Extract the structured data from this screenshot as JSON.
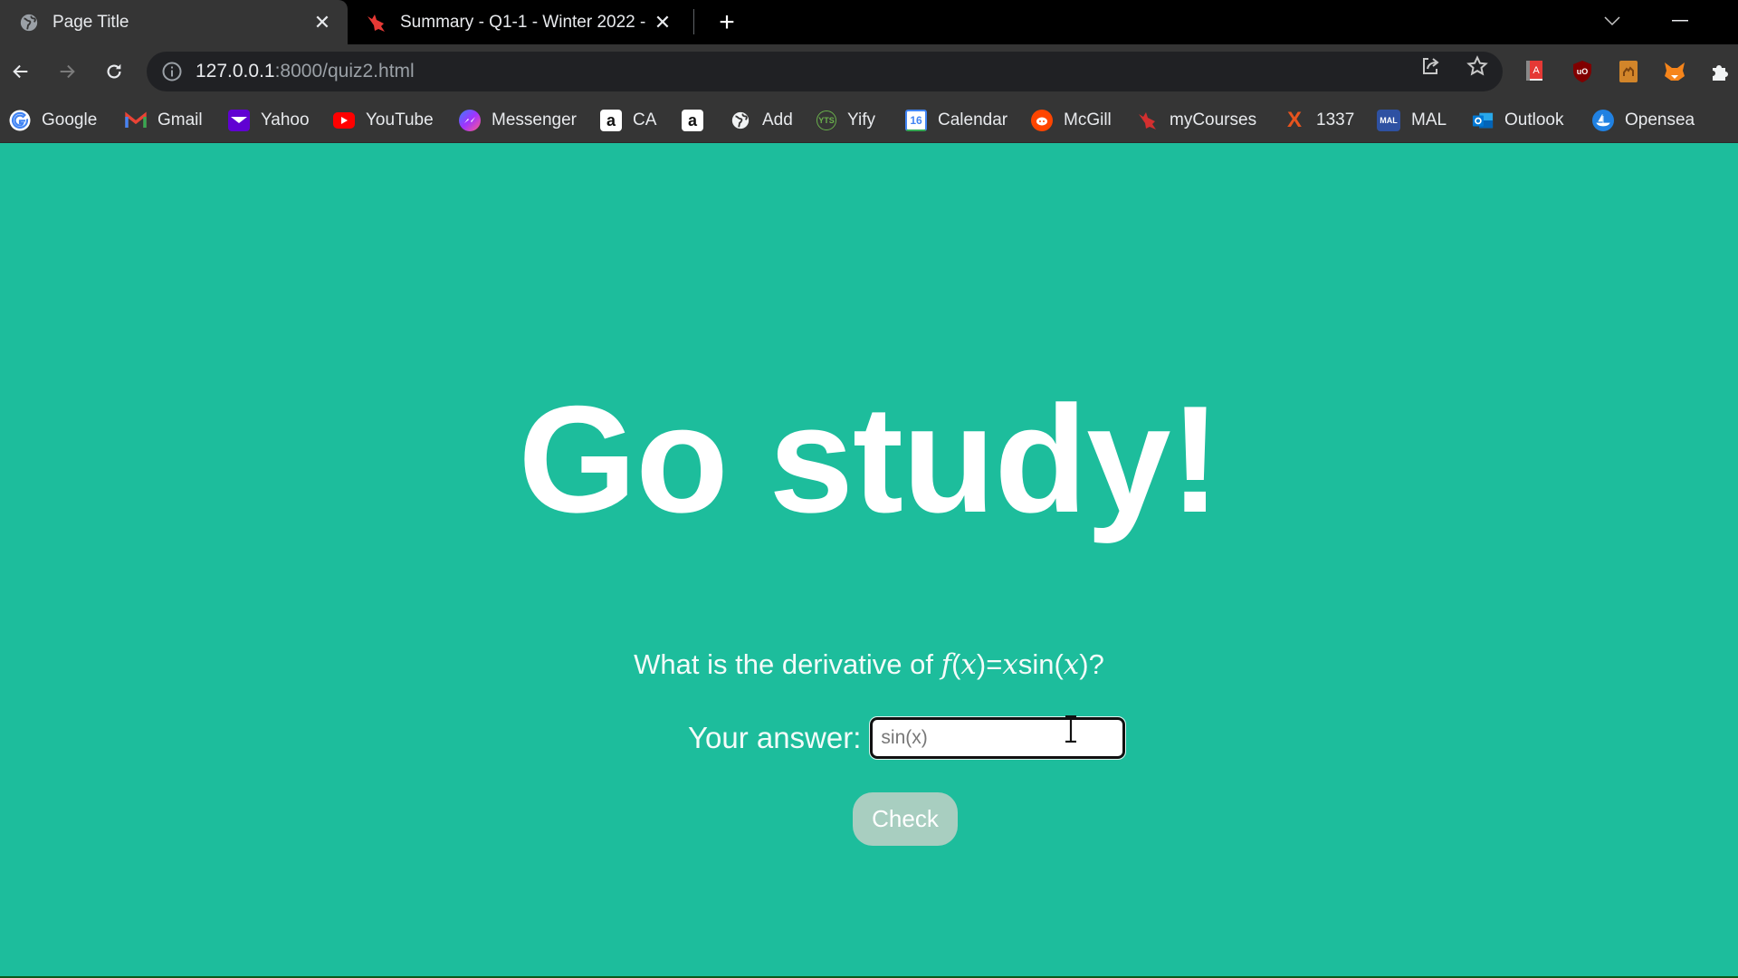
{
  "browser": {
    "tabs": [
      {
        "title": "Page Title",
        "icon": "globe-icon",
        "active": true
      },
      {
        "title": "Summary - Q1-1 - Winter 2022 -",
        "icon": "mycourses-bird-icon",
        "active": false
      }
    ],
    "close_glyph": "✕",
    "new_tab_glyph": "+",
    "address": {
      "host": "127.0.0.1",
      "rest": ":8000/quiz2.html"
    },
    "toolbar_icons": [
      "back-arrow-icon",
      "forward-arrow-icon",
      "reload-icon",
      "info-icon",
      "share-icon",
      "star-icon"
    ],
    "extensions": [
      "dictionary-extension-icon",
      "ublock-origin-icon",
      "camel-extension-icon",
      "metamask-fox-icon",
      "puzzle-extensions-icon"
    ],
    "bookmarks": [
      {
        "label": "Google",
        "icon": "google-icon",
        "color": "#4285f4"
      },
      {
        "label": "Gmail",
        "icon": "gmail-icon",
        "color": "#ea4335"
      },
      {
        "label": "Yahoo",
        "icon": "yahoo-icon",
        "color": "#6001d2"
      },
      {
        "label": "YouTube",
        "icon": "youtube-icon",
        "color": "#ff0000"
      },
      {
        "label": "Messenger",
        "icon": "messenger-icon",
        "color": "#a033ff"
      },
      {
        "label": "CA",
        "icon": "amazon-icon",
        "color": "#ffffff"
      },
      {
        "label": "",
        "icon": "amazon-icon",
        "color": "#ffffff"
      },
      {
        "label": "Add",
        "icon": "globe-icon",
        "color": "#ffffff"
      },
      {
        "label": "Yify",
        "icon": "yts-icon",
        "color": "#6ab04c"
      },
      {
        "label": "Calendar",
        "icon": "google-calendar-icon",
        "color": "#4285f4"
      },
      {
        "label": "McGill",
        "icon": "reddit-icon",
        "color": "#ff4500"
      },
      {
        "label": "myCourses",
        "icon": "mycourses-bird-icon",
        "color": "#d32f2f"
      },
      {
        "label": "1337",
        "icon": "1337x-icon",
        "color": "#e8541e"
      },
      {
        "label": "MAL",
        "icon": "myanimelist-icon",
        "color": "#2e51a2"
      },
      {
        "label": "Outlook",
        "icon": "outlook-icon",
        "color": "#0078d4"
      },
      {
        "label": "Opensea",
        "icon": "opensea-icon",
        "color": "#2081e2"
      }
    ]
  },
  "page": {
    "background": "#1dbd9c",
    "headline": "Go study!",
    "question": {
      "prefix": "What is the derivative of ",
      "f": "f",
      "lp1": "(",
      "x1": "x",
      "rp1": ")=",
      "x2": "x",
      "sin": "sin(",
      "x3": "x",
      "suffix": ")?"
    },
    "answer_label": "Your answer:",
    "answer_value": "sin(x)",
    "check_label": "Check"
  }
}
